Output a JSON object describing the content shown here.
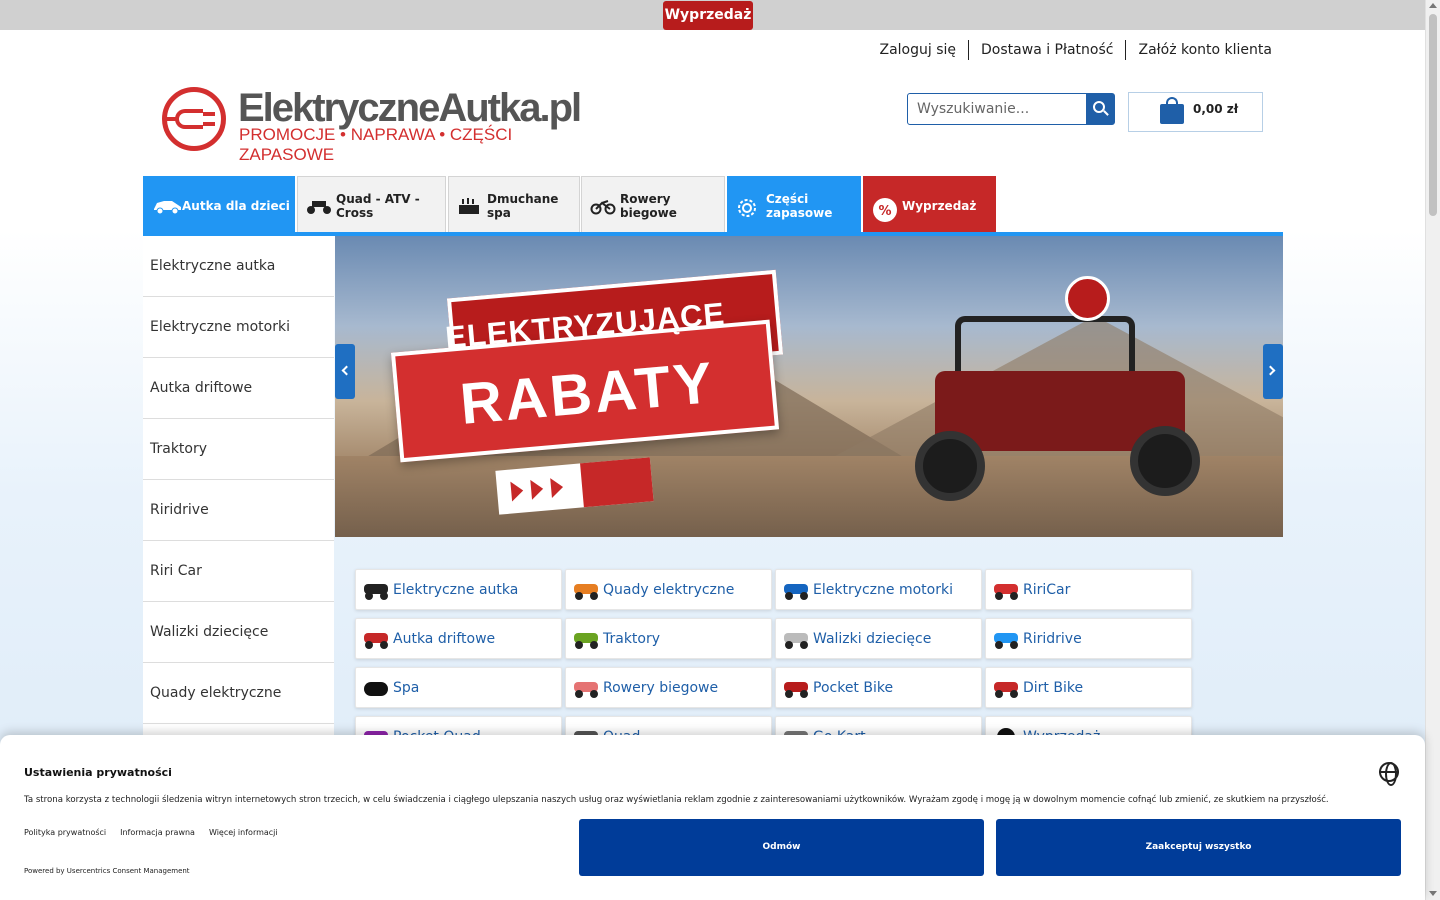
{
  "topbar": {
    "sale_label": "Wyprzedaż"
  },
  "header": {
    "links": [
      "Zaloguj się",
      "Dostawa i Płatność",
      "Załóż konto klienta"
    ],
    "logo_name": "ElektryczneAutka.pl",
    "logo_tagline": "PROMOCJE • NAPRAWA • CZĘŚCI ZAPASOWE",
    "search_placeholder": "Wyszukiwanie...",
    "cart_total": "0,00 zł"
  },
  "nav": {
    "tabs": [
      {
        "label": "Autka dla dzieci",
        "icon": "car-icon"
      },
      {
        "label": "Quad - ATV - Cross",
        "icon": "atv-icon"
      },
      {
        "label": "Dmuchane spa",
        "icon": "hot-tub-icon"
      },
      {
        "label": "Rowery biegowe",
        "icon": "balance-bike-icon"
      },
      {
        "label": "Części zapasowe",
        "icon": "gear-icon"
      },
      {
        "label": "Wyprzedaż",
        "icon": "percent-icon"
      }
    ]
  },
  "sidebar": {
    "items": [
      "Elektryczne autka",
      "Elektryczne motorki",
      "Autka driftowe",
      "Traktory",
      "Riridrive",
      "Riri Car",
      "Walizki dziecięce",
      "Quady elektryczne"
    ]
  },
  "banner": {
    "line1": "ELEKTRYZUJĄCE",
    "line2": "RABATY"
  },
  "categories": [
    "Elektryczne autka",
    "Quady elektryczne",
    "Elektryczne motorki",
    "RiriCar",
    "Autka driftowe",
    "Traktory",
    "Walizki dziecięce",
    "Riridrive",
    "Spa",
    "Rowery biegowe",
    "Pocket Bike",
    "Dirt Bike",
    "Pocket Quad",
    "Quad",
    "Go Kart",
    "Wyprzedaż"
  ],
  "cookie": {
    "title": "Ustawienia prywatności",
    "description": "Ta strona korzysta z technologii śledzenia witryn internetowych stron trzecich, w celu świadczenia i ciągłego ulepszania naszych usług oraz wyświetlania reklam zgodnie z zainteresowaniami użytkowników. Wyrażam zgodę i mogę ją w dowolnym momencie cofnąć lub zmienić, ze skutkiem na przyszłość.",
    "links": [
      "Polityka prywatności",
      "Informacja prawna",
      "Więcej informacji"
    ],
    "powered": "Powered by Usercentrics Consent Management",
    "deny": "Odmów",
    "accept": "Zaakceptuj wszystko"
  },
  "colors": {
    "brand_red": "#d32f2f",
    "brand_blue": "#1f5fa8",
    "nav_blue": "#2196f3",
    "consent_blue": "#003c99"
  }
}
